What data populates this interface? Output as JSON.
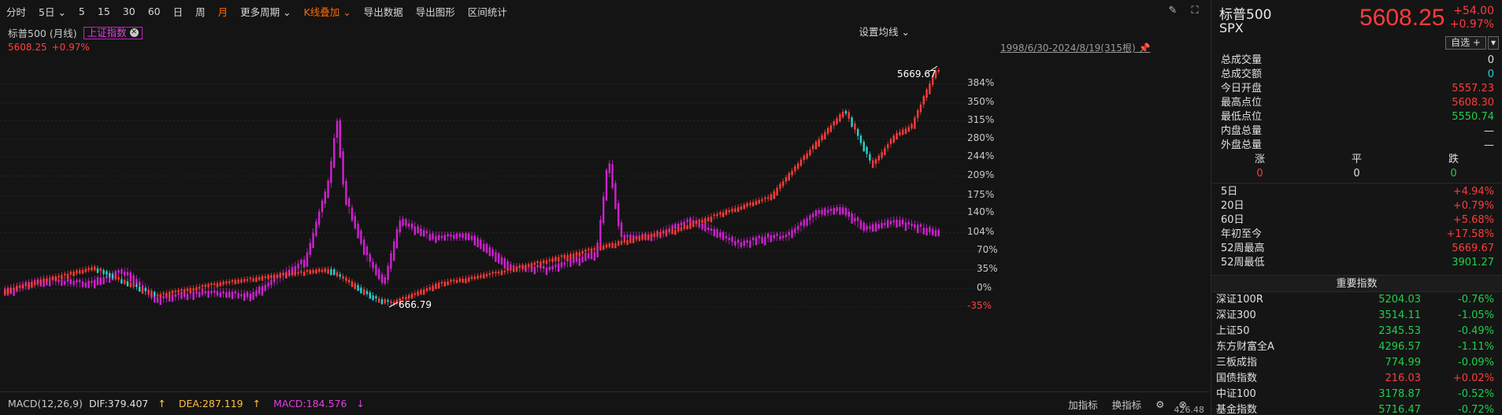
{
  "toolbar": {
    "items": [
      "分时",
      "5日",
      "5",
      "15",
      "30",
      "60",
      "日",
      "周",
      "月",
      "更多周期",
      "K线叠加",
      "导出数据",
      "导出图形",
      "区间统计"
    ],
    "active": "月"
  },
  "chart_header": {
    "title": "标普500 (月线)",
    "overlay_tag": "上证指数",
    "price": "5608.25",
    "change_pct": "+0.97%",
    "set_ma": "设置均线",
    "date_range": "1998/6/30-2024/8/19(315根)"
  },
  "y_axis_labels": [
    "384%",
    "350%",
    "315%",
    "280%",
    "244%",
    "209%",
    "175%",
    "140%",
    "104%",
    "70%",
    "35%",
    "0%",
    "-35%"
  ],
  "annotations": {
    "high": "5669.67",
    "low": "666.79"
  },
  "macd": {
    "name": "MACD(12,26,9)",
    "dif": "DIF:379.407",
    "dea": "DEA:287.119",
    "macd": "MACD:184.576",
    "add_indicator": "加指标",
    "switch_indicator": "换指标",
    "axis_value": "426.48"
  },
  "quote": {
    "name": "标普500",
    "code": "SPX",
    "price": "5608.25",
    "change": "+54.00",
    "change_pct": "+0.97%",
    "watchlist_btn": "自选 +",
    "rows": [
      {
        "k": "总成交量",
        "v": "0",
        "c": "white"
      },
      {
        "k": "总成交额",
        "v": "0",
        "c": "cyan"
      },
      {
        "k": "今日开盘",
        "v": "5557.23",
        "c": "red"
      },
      {
        "k": "最高点位",
        "v": "5608.30",
        "c": "red"
      },
      {
        "k": "最低点位",
        "v": "5550.74",
        "c": "green"
      },
      {
        "k": "内盘总量",
        "v": "—",
        "c": "white"
      },
      {
        "k": "外盘总量",
        "v": "—",
        "c": "white"
      }
    ],
    "breadth_labels": [
      "涨",
      "平",
      "跌"
    ],
    "breadth_values": [
      "0",
      "0",
      "0"
    ],
    "perf": [
      {
        "k": "5日",
        "v": "+4.94%",
        "c": "red"
      },
      {
        "k": "20日",
        "v": "+0.79%",
        "c": "red"
      },
      {
        "k": "60日",
        "v": "+5.68%",
        "c": "red"
      },
      {
        "k": "年初至今",
        "v": "+17.58%",
        "c": "red"
      },
      {
        "k": "52周最高",
        "v": "5669.67",
        "c": "red"
      },
      {
        "k": "52周最低",
        "v": "3901.27",
        "c": "green"
      }
    ]
  },
  "indices": {
    "title": "重要指数",
    "rows": [
      {
        "n": "深证100R",
        "v": "5204.03",
        "p": "-0.76%",
        "vc": "green",
        "pc": "green"
      },
      {
        "n": "深证300",
        "v": "3514.11",
        "p": "-1.05%",
        "vc": "green",
        "pc": "green"
      },
      {
        "n": "上证50",
        "v": "2345.53",
        "p": "-0.49%",
        "vc": "green",
        "pc": "green"
      },
      {
        "n": "东方财富全A",
        "v": "4296.57",
        "p": "-1.11%",
        "vc": "green",
        "pc": "green"
      },
      {
        "n": "三板成指",
        "v": "774.99",
        "p": "-0.09%",
        "vc": "green",
        "pc": "green"
      },
      {
        "n": "国债指数",
        "v": "216.03",
        "p": "+0.02%",
        "vc": "red",
        "pc": "red"
      },
      {
        "n": "中证100",
        "v": "3178.87",
        "p": "-0.52%",
        "vc": "green",
        "pc": "green"
      },
      {
        "n": "基金指数",
        "v": "5716.47",
        "p": "-0.72%",
        "vc": "green",
        "pc": "green"
      }
    ]
  },
  "colors": {
    "up": "#ff3b3b",
    "down": "#2ad0d0",
    "overlay": "#d020d0",
    "accent": "#ff6a00"
  }
}
